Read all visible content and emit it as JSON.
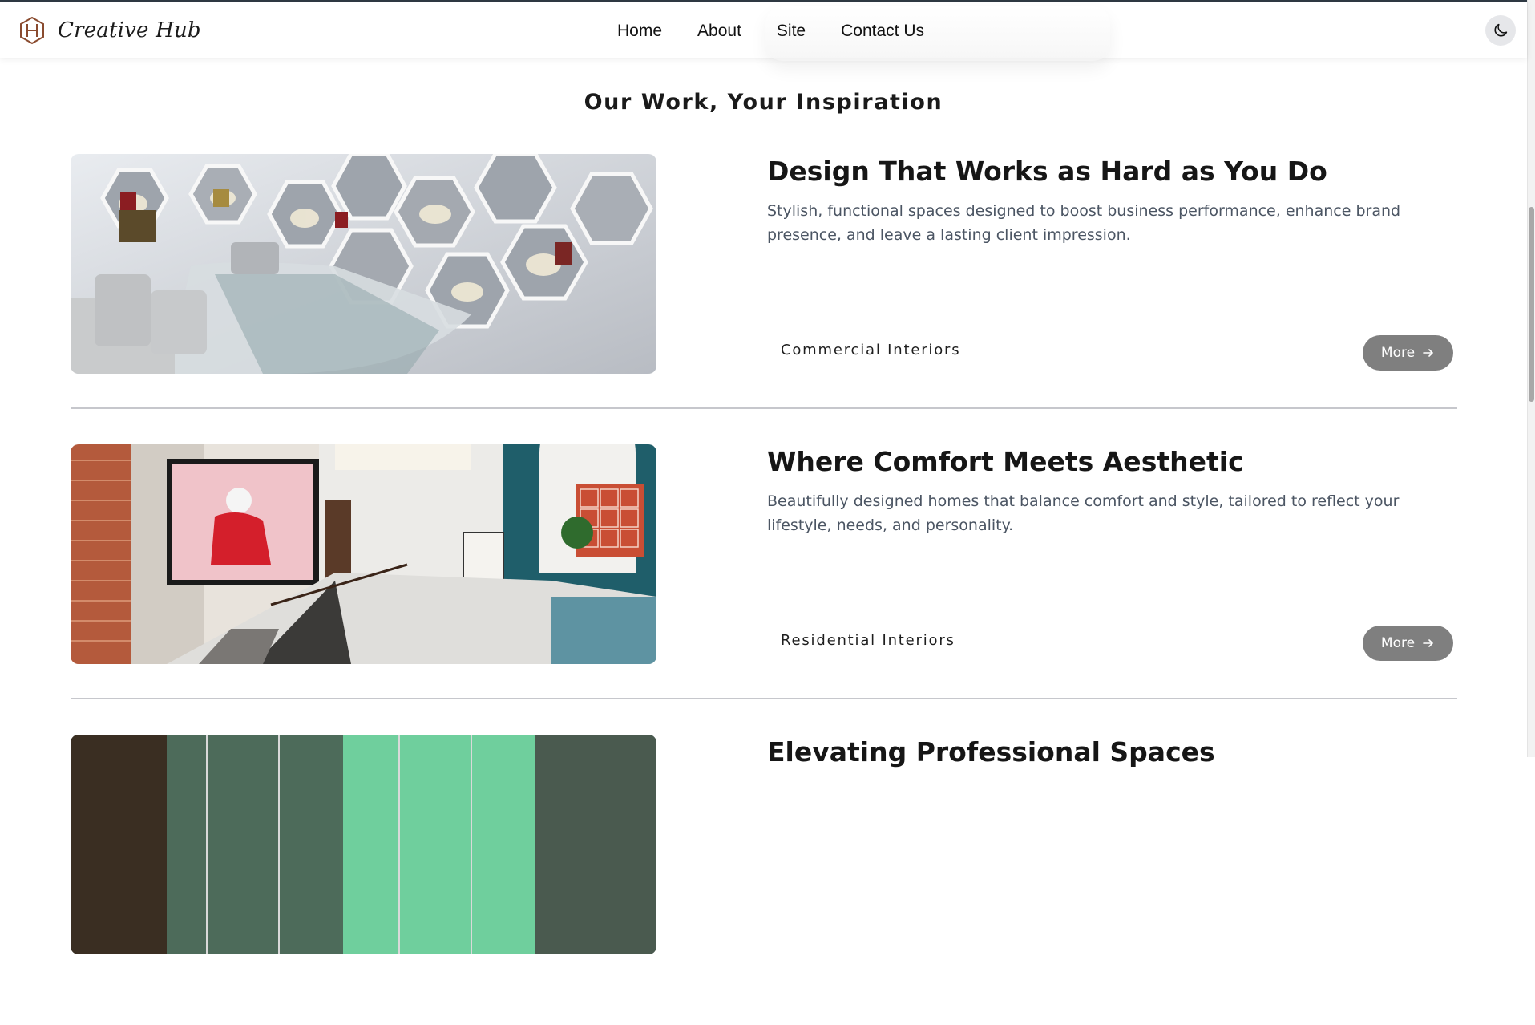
{
  "header": {
    "brand_name": "Creative Hub",
    "nav": [
      "Home",
      "About",
      "Site",
      "Contact Us"
    ],
    "theme_toggle_icon": "moon-icon"
  },
  "main": {
    "heading": "Our Work, Your Inspiration",
    "cards": [
      {
        "title": "Design That Works as Hard as You Do",
        "description": "Stylish, functional spaces designed to boost business performance, enhance brand presence, and leave a lasting client impression.",
        "category": "Commercial Interiors",
        "button_label": "More",
        "image_icon": "commercial-interior-photo"
      },
      {
        "title": "Where Comfort Meets Aesthetic",
        "description": "Beautifully designed homes that balance comfort and style, tailored to reflect your lifestyle, needs, and personality.",
        "category": "Residential Interiors",
        "button_label": "More",
        "image_icon": "residential-interior-photo"
      },
      {
        "title": "Elevating Professional Spaces",
        "image_icon": "office-interior-photo"
      }
    ]
  },
  "colors": {
    "accent_dark": "#2f3a44",
    "button_gray": "#7f7f7f",
    "text_muted": "#4b5563",
    "divider": "#c6c7cc"
  }
}
